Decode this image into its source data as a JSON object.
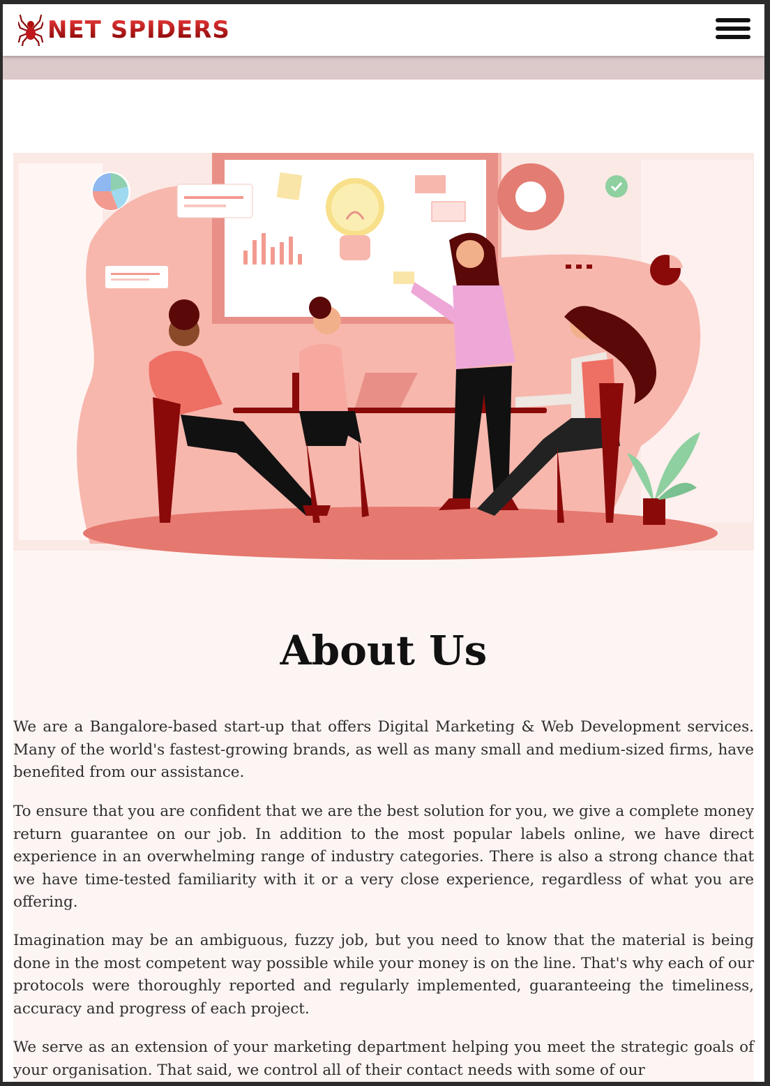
{
  "header": {
    "brand": "NET SPIDERS",
    "logo_icon": "spider-icon",
    "menu_icon": "hamburger-menu-icon"
  },
  "about": {
    "title": "About Us",
    "paragraphs": [
      "We are a Bangalore-based start-up that offers Digital Marketing & Web Development services. Many of the world's fastest-growing brands, as well as many small and medium-sized firms, have benefited from our assistance.",
      "To ensure that you are confident that we are the best solution for you, we give a complete money return guarantee on our job. In addition to the most popular labels online, we have direct experience in an overwhelming range of industry categories. There is also a strong chance that we have time-tested familiarity with it or a very close experience, regardless of what you are offering.",
      "Imagination may be an ambiguous, fuzzy job, but you need to know that the material is being done in the most competent way possible while your money is on the line. That's why each of our protocols were thoroughly reported and regularly implemented, guaranteeing the timeliness, accuracy and progress of each project.",
      "We serve as an extension of your marketing department helping you meet the strategic goals of your organisation. That said, we control all of their contact needs with some of our"
    ]
  },
  "colors": {
    "brand_red": "#c0181b",
    "accent_pink": "#f7b7ad",
    "dark_red": "#8a0a0a"
  }
}
